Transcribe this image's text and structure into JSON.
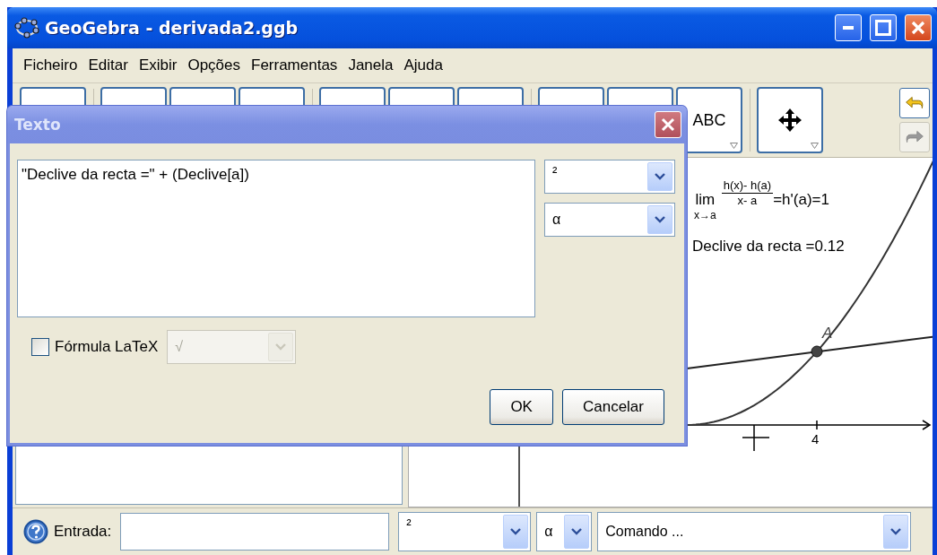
{
  "window": {
    "title": "GeoGebra - derivada2.ggb"
  },
  "menu": [
    "Ficheiro",
    "Editar",
    "Exibir",
    "Opções",
    "Ferramentas",
    "Janela",
    "Ajuda"
  ],
  "toolbar": {
    "tools": [
      {
        "kind": "blank",
        "group_end": true
      },
      {
        "kind": "blank"
      },
      {
        "kind": "blank"
      },
      {
        "kind": "blank",
        "group_end": true
      },
      {
        "kind": "blank"
      },
      {
        "kind": "blank"
      },
      {
        "kind": "blank",
        "group_end": true
      },
      {
        "kind": "blank"
      },
      {
        "kind": "blank"
      },
      {
        "kind": "text",
        "label": "ABC",
        "group_end": true
      },
      {
        "kind": "move"
      }
    ],
    "undo": {
      "disabled": false
    },
    "redo": {
      "disabled": true
    }
  },
  "graphics": {
    "lim": "lim",
    "lim_sub": "x→a",
    "numerator": "h(x)- h(a)",
    "denominator": "x- a",
    "result": "=h'(a)=1",
    "slope_text": "Declive da recta =0.12",
    "point_label": "A",
    "x_tick_label": "4"
  },
  "input_bar": {
    "label": "Entrada:",
    "symbols": "²",
    "greek": "α",
    "command": "Comando ..."
  },
  "dialog": {
    "title": "Texto",
    "text": "\"Declive da recta =\" + (Declive[a])",
    "symbols": "²",
    "greek": "α",
    "latex": {
      "label": "Fórmula LaTeX",
      "checked": false
    },
    "latex_combo": {
      "value": "√",
      "disabled": true
    },
    "buttons": [
      "OK",
      "Cancelar"
    ]
  }
}
